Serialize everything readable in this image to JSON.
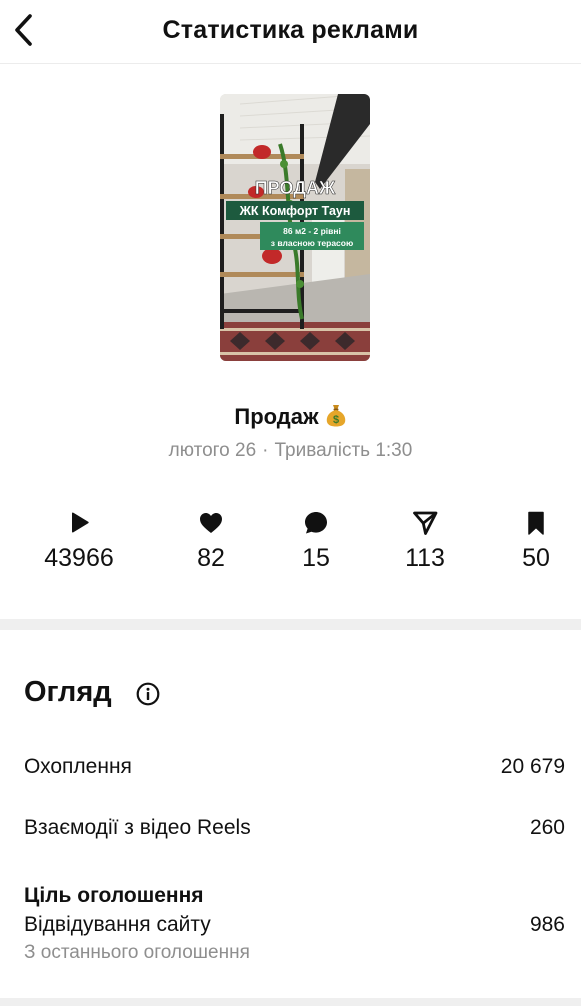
{
  "header": {
    "title": "Статистика реклами",
    "back_icon": "chevron-left-icon"
  },
  "reel": {
    "thumbnail": {
      "headline": "ПРОДАЖ",
      "subhead": "ЖК Комфорт Таун",
      "badge_line1": "86 м2 - 2 рівні",
      "badge_line2": "з власною терасою"
    },
    "title": "Продаж",
    "title_emoji": "money-bag-icon",
    "date": "лютого 26",
    "duration_label": "Тривалість 1:30"
  },
  "stats": [
    {
      "icon": "play-icon",
      "value": "43966"
    },
    {
      "icon": "heart-icon",
      "value": "82"
    },
    {
      "icon": "comment-icon",
      "value": "15"
    },
    {
      "icon": "share-icon",
      "value": "113"
    },
    {
      "icon": "bookmark-icon",
      "value": "50"
    }
  ],
  "overview": {
    "title": "Огляд",
    "rows": [
      {
        "label": "Охоплення",
        "value": "20 679"
      },
      {
        "label": "Взаємодії з відео Reels",
        "value": "260"
      }
    ],
    "goal": {
      "heading": "Ціль оголошення",
      "label": "Відвідування сайту",
      "value": "986",
      "note": "З останнього оголошення"
    }
  }
}
